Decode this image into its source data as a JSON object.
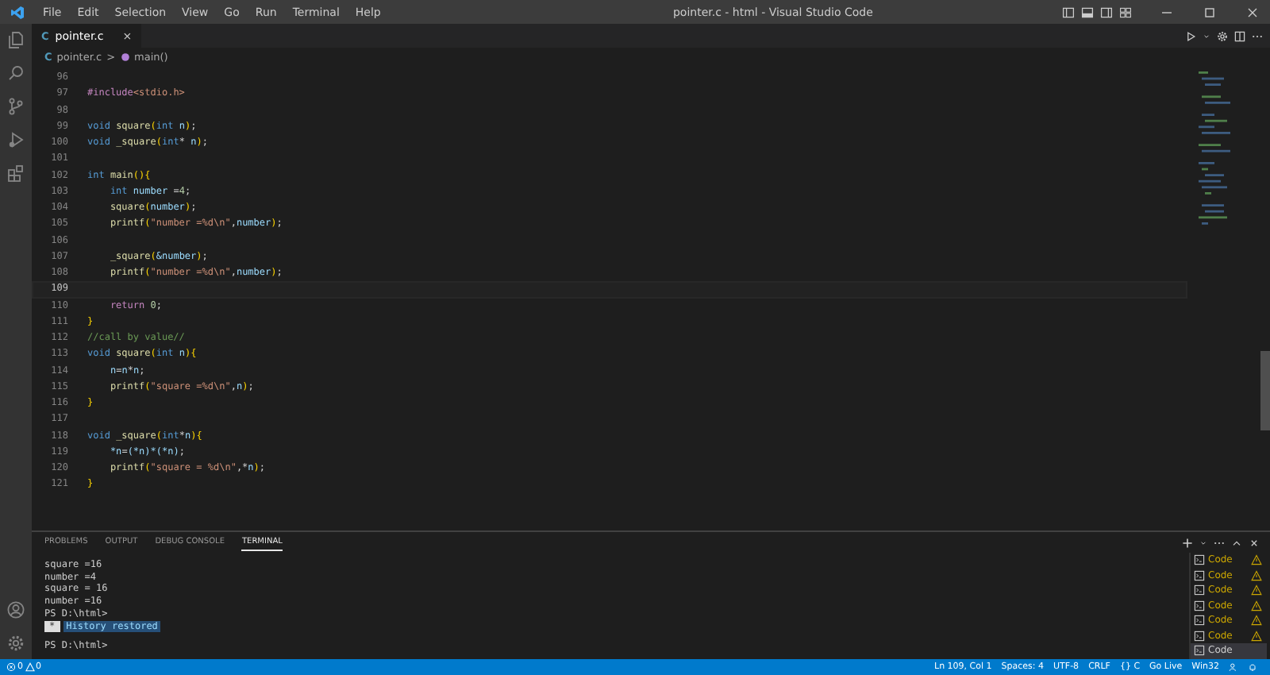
{
  "menu": [
    "File",
    "Edit",
    "Selection",
    "View",
    "Go",
    "Run",
    "Terminal",
    "Help"
  ],
  "window": {
    "title": "pointer.c - html - Visual Studio Code"
  },
  "tabs": [
    {
      "icon": "C",
      "label": "pointer.c",
      "close": "×",
      "selected": true
    }
  ],
  "breadcrumb": {
    "icon": "C",
    "file": "pointer.c",
    "separator": ">",
    "symbol": "main()"
  },
  "code": [
    {
      "num": "96",
      "current": false
    },
    {
      "num": "97",
      "current": false,
      "tokens": [
        {
          "text": "#include",
          "kind": "macro"
        },
        {
          "text": "<stdio.h>",
          "kind": "string"
        }
      ]
    },
    {
      "num": "98",
      "current": false
    },
    {
      "num": "99",
      "current": false,
      "tokens": [
        {
          "text": "void ",
          "kind": "keyword"
        },
        {
          "text": "square",
          "kind": "func"
        },
        {
          "text": "(",
          "kind": "bracket"
        },
        {
          "text": "int ",
          "kind": "keyword"
        },
        {
          "text": "n",
          "kind": "var"
        },
        {
          "text": ")",
          "kind": "bracket"
        },
        {
          "text": ";",
          "kind": "plain"
        }
      ]
    },
    {
      "num": "100",
      "current": false,
      "tokens": [
        {
          "text": "void ",
          "kind": "keyword"
        },
        {
          "text": "_square",
          "kind": "func"
        },
        {
          "text": "(",
          "kind": "bracket"
        },
        {
          "text": "int",
          "kind": "keyword"
        },
        {
          "text": "* ",
          "kind": "plain"
        },
        {
          "text": "n",
          "kind": "var"
        },
        {
          "text": ")",
          "kind": "bracket"
        },
        {
          "text": ";",
          "kind": "plain"
        }
      ]
    },
    {
      "num": "101",
      "current": false
    },
    {
      "num": "102",
      "current": false,
      "tokens": [
        {
          "text": "int ",
          "kind": "keyword"
        },
        {
          "text": "main",
          "kind": "func"
        },
        {
          "text": "(){",
          "kind": "bracket"
        }
      ]
    },
    {
      "num": "103",
      "current": false,
      "tokens": [
        {
          "text": "    int ",
          "kind": "keyword"
        },
        {
          "text": "number",
          "kind": "var"
        },
        {
          "text": " =",
          "kind": "plain"
        },
        {
          "text": "4",
          "kind": "number"
        },
        {
          "text": ";",
          "kind": "plain"
        }
      ]
    },
    {
      "num": "104",
      "current": false,
      "tokens": [
        {
          "text": "    square",
          "kind": "func"
        },
        {
          "text": "(",
          "kind": "bracket"
        },
        {
          "text": "number",
          "kind": "var"
        },
        {
          "text": ")",
          "kind": "bracket"
        },
        {
          "text": ";",
          "kind": "plain"
        }
      ]
    },
    {
      "num": "105",
      "current": false,
      "tokens": [
        {
          "text": "    printf",
          "kind": "func"
        },
        {
          "text": "(",
          "kind": "bracket"
        },
        {
          "text": "\"number =%d\\n\"",
          "kind": "string"
        },
        {
          "text": ",",
          "kind": "plain"
        },
        {
          "text": "number",
          "kind": "var"
        },
        {
          "text": ")",
          "kind": "bracket"
        },
        {
          "text": ";",
          "kind": "plain"
        }
      ]
    },
    {
      "num": "106",
      "current": false
    },
    {
      "num": "107",
      "current": false,
      "tokens": [
        {
          "text": "    _square",
          "kind": "func"
        },
        {
          "text": "(",
          "kind": "bracket"
        },
        {
          "text": "&number",
          "kind": "var"
        },
        {
          "text": ")",
          "kind": "bracket"
        },
        {
          "text": ";",
          "kind": "plain"
        }
      ]
    },
    {
      "num": "108",
      "current": false,
      "tokens": [
        {
          "text": "    printf",
          "kind": "func"
        },
        {
          "text": "(",
          "kind": "bracket"
        },
        {
          "text": "\"number =%d\\n\"",
          "kind": "string"
        },
        {
          "text": ",",
          "kind": "plain"
        },
        {
          "text": "number",
          "kind": "var"
        },
        {
          "text": ")",
          "kind": "bracket"
        },
        {
          "text": ";",
          "kind": "plain"
        }
      ]
    },
    {
      "num": "109",
      "current": true
    },
    {
      "num": "110",
      "current": false,
      "tokens": [
        {
          "text": "    return ",
          "kind": "macro"
        },
        {
          "text": "0",
          "kind": "number"
        },
        {
          "text": ";",
          "kind": "plain"
        }
      ]
    },
    {
      "num": "111",
      "current": false,
      "tokens": [
        {
          "text": "}",
          "kind": "bracket"
        }
      ]
    },
    {
      "num": "112",
      "current": false,
      "tokens": [
        {
          "text": "//call by value//",
          "kind": "comment"
        }
      ]
    },
    {
      "num": "113",
      "current": false,
      "tokens": [
        {
          "text": "void ",
          "kind": "keyword"
        },
        {
          "text": "square",
          "kind": "func"
        },
        {
          "text": "(",
          "kind": "bracket"
        },
        {
          "text": "int ",
          "kind": "keyword"
        },
        {
          "text": "n",
          "kind": "var"
        },
        {
          "text": "){",
          "kind": "bracket"
        }
      ]
    },
    {
      "num": "114",
      "current": false,
      "tokens": [
        {
          "text": "    n",
          "kind": "var"
        },
        {
          "text": "=",
          "kind": "plain"
        },
        {
          "text": "n",
          "kind": "var"
        },
        {
          "text": "*",
          "kind": "plain"
        },
        {
          "text": "n",
          "kind": "var"
        },
        {
          "text": ";",
          "kind": "plain"
        }
      ]
    },
    {
      "num": "115",
      "current": false,
      "tokens": [
        {
          "text": "    printf",
          "kind": "func"
        },
        {
          "text": "(",
          "kind": "bracket"
        },
        {
          "text": "\"square =%d\\n\"",
          "kind": "string"
        },
        {
          "text": ",",
          "kind": "plain"
        },
        {
          "text": "n",
          "kind": "var"
        },
        {
          "text": ")",
          "kind": "bracket"
        },
        {
          "text": ";",
          "kind": "plain"
        }
      ]
    },
    {
      "num": "116",
      "current": false,
      "tokens": [
        {
          "text": "}",
          "kind": "bracket"
        }
      ]
    },
    {
      "num": "117",
      "current": false
    },
    {
      "num": "118",
      "current": false,
      "tokens": [
        {
          "text": "void ",
          "kind": "keyword"
        },
        {
          "text": "_square",
          "kind": "func"
        },
        {
          "text": "(",
          "kind": "bracket"
        },
        {
          "text": "int",
          "kind": "keyword"
        },
        {
          "text": "*",
          "kind": "plain"
        },
        {
          "text": "n",
          "kind": "var"
        },
        {
          "text": "){",
          "kind": "bracket"
        }
      ]
    },
    {
      "num": "119",
      "current": false,
      "tokens": [
        {
          "text": "    *n",
          "kind": "var"
        },
        {
          "text": "=",
          "kind": "plain"
        },
        {
          "text": "(*n)*(*n)",
          "kind": "var"
        },
        {
          "text": ";",
          "kind": "plain"
        }
      ]
    },
    {
      "num": "120",
      "current": false,
      "tokens": [
        {
          "text": "    printf",
          "kind": "func"
        },
        {
          "text": "(",
          "kind": "bracket"
        },
        {
          "text": "\"square = %d\\n\"",
          "kind": "string"
        },
        {
          "text": ",*",
          "kind": "plain"
        },
        {
          "text": "n",
          "kind": "var"
        },
        {
          "text": ")",
          "kind": "bracket"
        },
        {
          "text": ";",
          "kind": "plain"
        }
      ]
    },
    {
      "num": "121",
      "current": false,
      "tokens": [
        {
          "text": "}",
          "kind": "bracket"
        }
      ]
    }
  ],
  "panel_tabs": [
    {
      "label": "PROBLEMS",
      "selected": false
    },
    {
      "label": "OUTPUT",
      "selected": false
    },
    {
      "label": "DEBUG CONSOLE",
      "selected": false
    },
    {
      "label": "TERMINAL",
      "selected": true
    }
  ],
  "terminal": {
    "lines": [
      "square =16",
      "number =4",
      "square = 16",
      "number =16",
      "PS D:\\html>"
    ],
    "notice_mark": "*",
    "notice": "History restored",
    "prompt": "PS D:\\html>"
  },
  "terminal_list": [
    {
      "label": "Code",
      "warning": true,
      "selected": false
    },
    {
      "label": "Code",
      "warning": true,
      "selected": false
    },
    {
      "label": "Code",
      "warning": true,
      "selected": false
    },
    {
      "label": "Code",
      "warning": true,
      "selected": false
    },
    {
      "label": "Code",
      "warning": true,
      "selected": false
    },
    {
      "label": "Code",
      "warning": true,
      "selected": false
    },
    {
      "label": "Code",
      "warning": false,
      "selected": true
    }
  ],
  "status_bar": {
    "errors": "0",
    "warnings": "0",
    "right": [
      "Ln 109, Col 1",
      "Spaces: 4",
      "UTF-8",
      "CRLF",
      "{} C",
      "Go Live",
      "Win32"
    ]
  }
}
